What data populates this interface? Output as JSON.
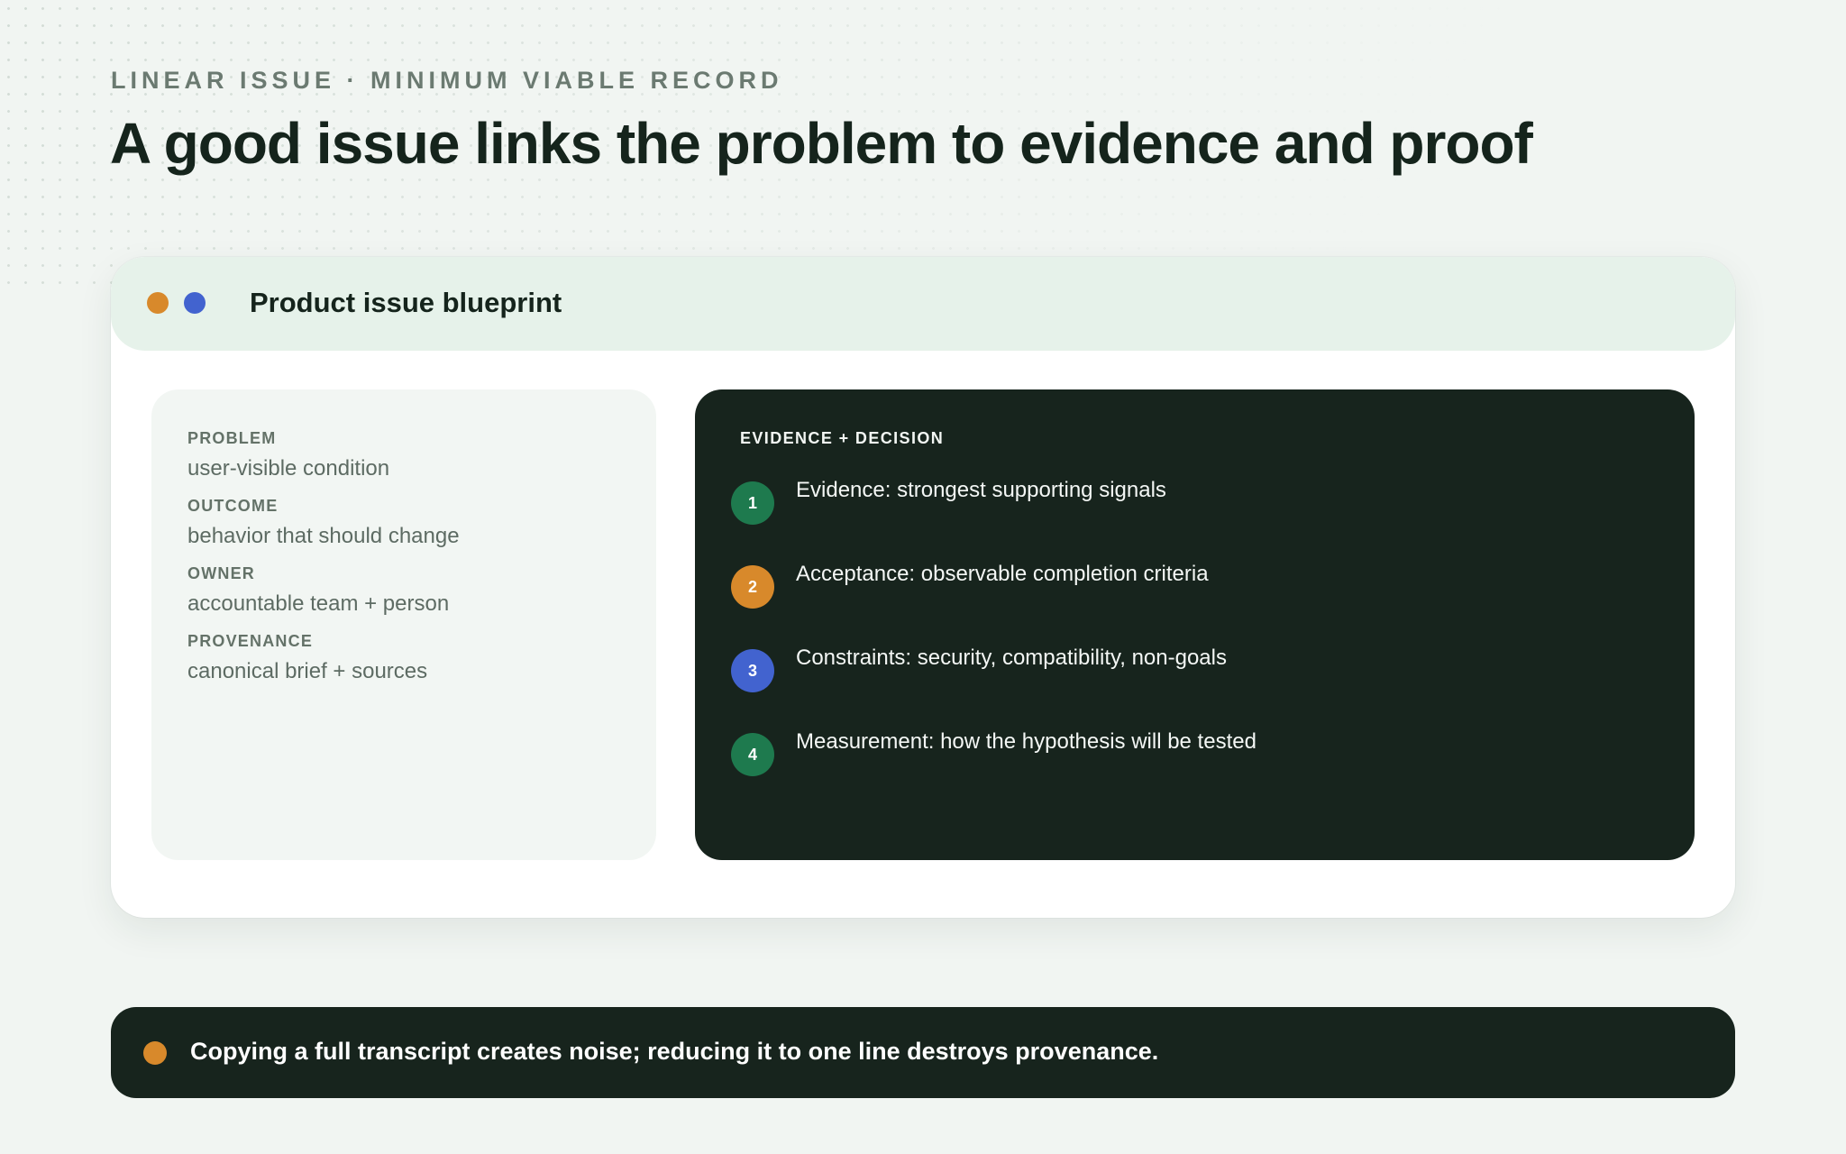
{
  "eyebrow": "LINEAR ISSUE · MINIMUM VIABLE RECORD",
  "headline": "A good issue links the problem to evidence and proof",
  "card": {
    "title": "Product issue blueprint",
    "header_dots": [
      "#d8892b",
      "#4263cf"
    ],
    "fields": [
      {
        "label": "PROBLEM",
        "value": "user-visible condition"
      },
      {
        "label": "OUTCOME",
        "value": "behavior that should change"
      },
      {
        "label": "OWNER",
        "value": "accountable team + person"
      },
      {
        "label": "PROVENANCE",
        "value": "canonical brief + sources"
      }
    ],
    "evidence": {
      "label": "EVIDENCE + DECISION",
      "steps": [
        {
          "num": "1",
          "text": "Evidence: strongest supporting signals",
          "color": "#1e7a4e"
        },
        {
          "num": "2",
          "text": "Acceptance: observable completion criteria",
          "color": "#d8892b"
        },
        {
          "num": "3",
          "text": "Constraints: security, compatibility, non-goals",
          "color": "#4263cf"
        },
        {
          "num": "4",
          "text": "Measurement: how the hypothesis will be tested",
          "color": "#1e7a4e"
        }
      ]
    }
  },
  "footer": {
    "text": "Copying a full transcript creates noise; reducing it to one line destroys provenance.",
    "dot_color": "#d8892b"
  }
}
